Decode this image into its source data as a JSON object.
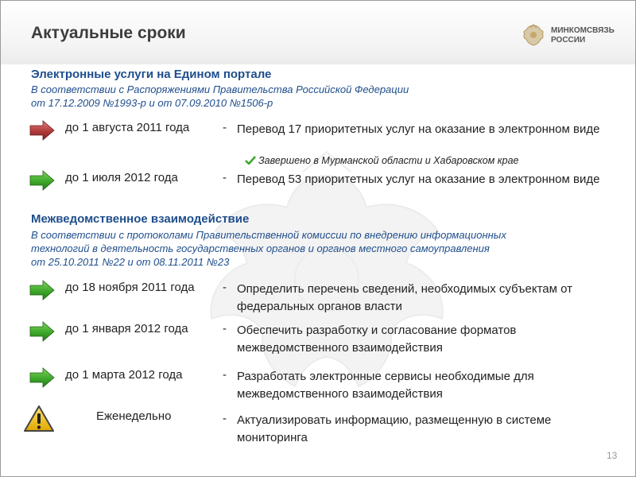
{
  "header": {
    "title": "Актуальные сроки",
    "logo_line1": "МИНКОМСВЯЗЬ",
    "logo_line2": "РОССИИ"
  },
  "section1": {
    "title": "Электронные услуги на Едином портале",
    "subtitle_line1": "В соответствии с Распоряжениями Правительства Российской Федерации",
    "subtitle_line2": "от 17.12.2009 №1993-р и от 07.09.2010 №1506-р",
    "items": [
      {
        "icon": "red-arrow-icon",
        "date": "до 1 августа 2011 года",
        "dash": "-",
        "text": "Перевод 17 приоритетных услуг на оказание в электронном виде",
        "note": "Завершено в Мурманской области и Хабаровском крае"
      },
      {
        "icon": "green-arrow-icon",
        "date": "до 1 июля 2012 года",
        "dash": "-",
        "text": "Перевод 53 приоритетных услуг на оказание в электронном виде"
      }
    ]
  },
  "section2": {
    "title": "Межведомственное взаимодействие",
    "subtitle_line1": "В соответствии с протоколами Правительственной комиссии по внедрению информационных",
    "subtitle_line2": "технологий в деятельность государственных органов и органов местного самоуправления",
    "subtitle_line3": "от 25.10.2011 №22 и от 08.11.2011 №23",
    "items": [
      {
        "icon": "green-arrow-icon",
        "date": "до 18 ноября 2011 года",
        "dash": "-",
        "text": "Определить перечень сведений, необходимых субъектам от федеральных органов власти"
      },
      {
        "icon": "green-arrow-icon",
        "date": "до 1 января 2012 года",
        "dash": "-",
        "text": "Обеспечить разработку и согласование форматов межведомственного взаимодействия"
      },
      {
        "icon": "green-arrow-icon",
        "date": "до 1 марта 2012 года",
        "dash": "-",
        "text": "Разработать электронные сервисы необходимые для межведомственного взаимодействия"
      },
      {
        "icon": "warning-icon",
        "date": "Еженедельно",
        "dash": "-",
        "text": "Актуализировать информацию, размещенную в системе мониторинга"
      }
    ]
  },
  "page_number": "13",
  "colors": {
    "heading_blue": "#1f4e8c",
    "title_gray": "#3c3c3c",
    "arrow_green": "#3ea82b",
    "arrow_red": "#b23a3a",
    "warning_yellow": "#f2c200"
  }
}
